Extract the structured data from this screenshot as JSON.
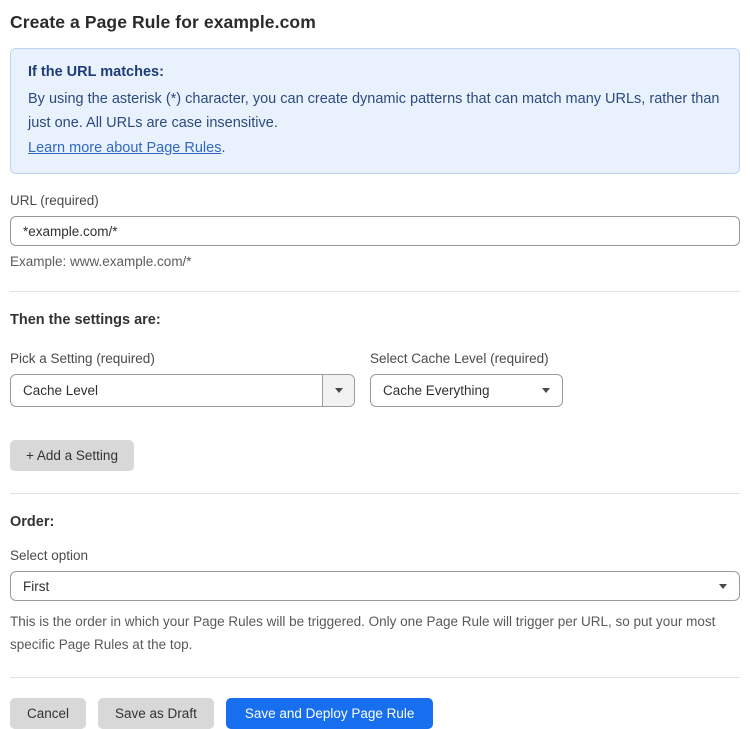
{
  "page": {
    "title": "Create a Page Rule for example.com"
  },
  "info_box": {
    "heading": "If the URL matches:",
    "body": "By using the asterisk (*) character, you can create dynamic patterns that can match many URLs, rather than just one. All URLs are case insensitive.",
    "link_text": "Learn more about Page Rules",
    "link_suffix": "."
  },
  "url_field": {
    "label": "URL (required)",
    "value": "*example.com/*",
    "example": "Example: www.example.com/*"
  },
  "settings_section": {
    "heading": "Then the settings are:",
    "setting_picker": {
      "label": "Pick a Setting (required)",
      "selected_value": "Cache Level"
    },
    "cache_level_select": {
      "label": "Select Cache Level (required)",
      "selected_value": "Cache Everything"
    },
    "add_setting_label": "+ Add a Setting"
  },
  "order_section": {
    "heading": "Order:",
    "label": "Select option",
    "selected_value": "First",
    "help": "This is the order in which your Page Rules will be triggered. Only one Page Rule will trigger per URL, so put your most specific Page Rules at the top."
  },
  "footer": {
    "cancel_label": "Cancel",
    "save_draft_label": "Save as Draft",
    "save_deploy_label": "Save and Deploy Page Rule"
  },
  "colors": {
    "info_box_background": "#e9f2fc",
    "info_box_border": "#bcd4ee",
    "info_box_text": "#2c4a80",
    "info_box_heading_text": "#1d3c78",
    "link_blue": "#3268c2",
    "primary_button_blue": "#176ff0",
    "secondary_button_gray": "#d8d8d8",
    "input_border": "#979797",
    "divider_gray": "#e2e2e2"
  }
}
